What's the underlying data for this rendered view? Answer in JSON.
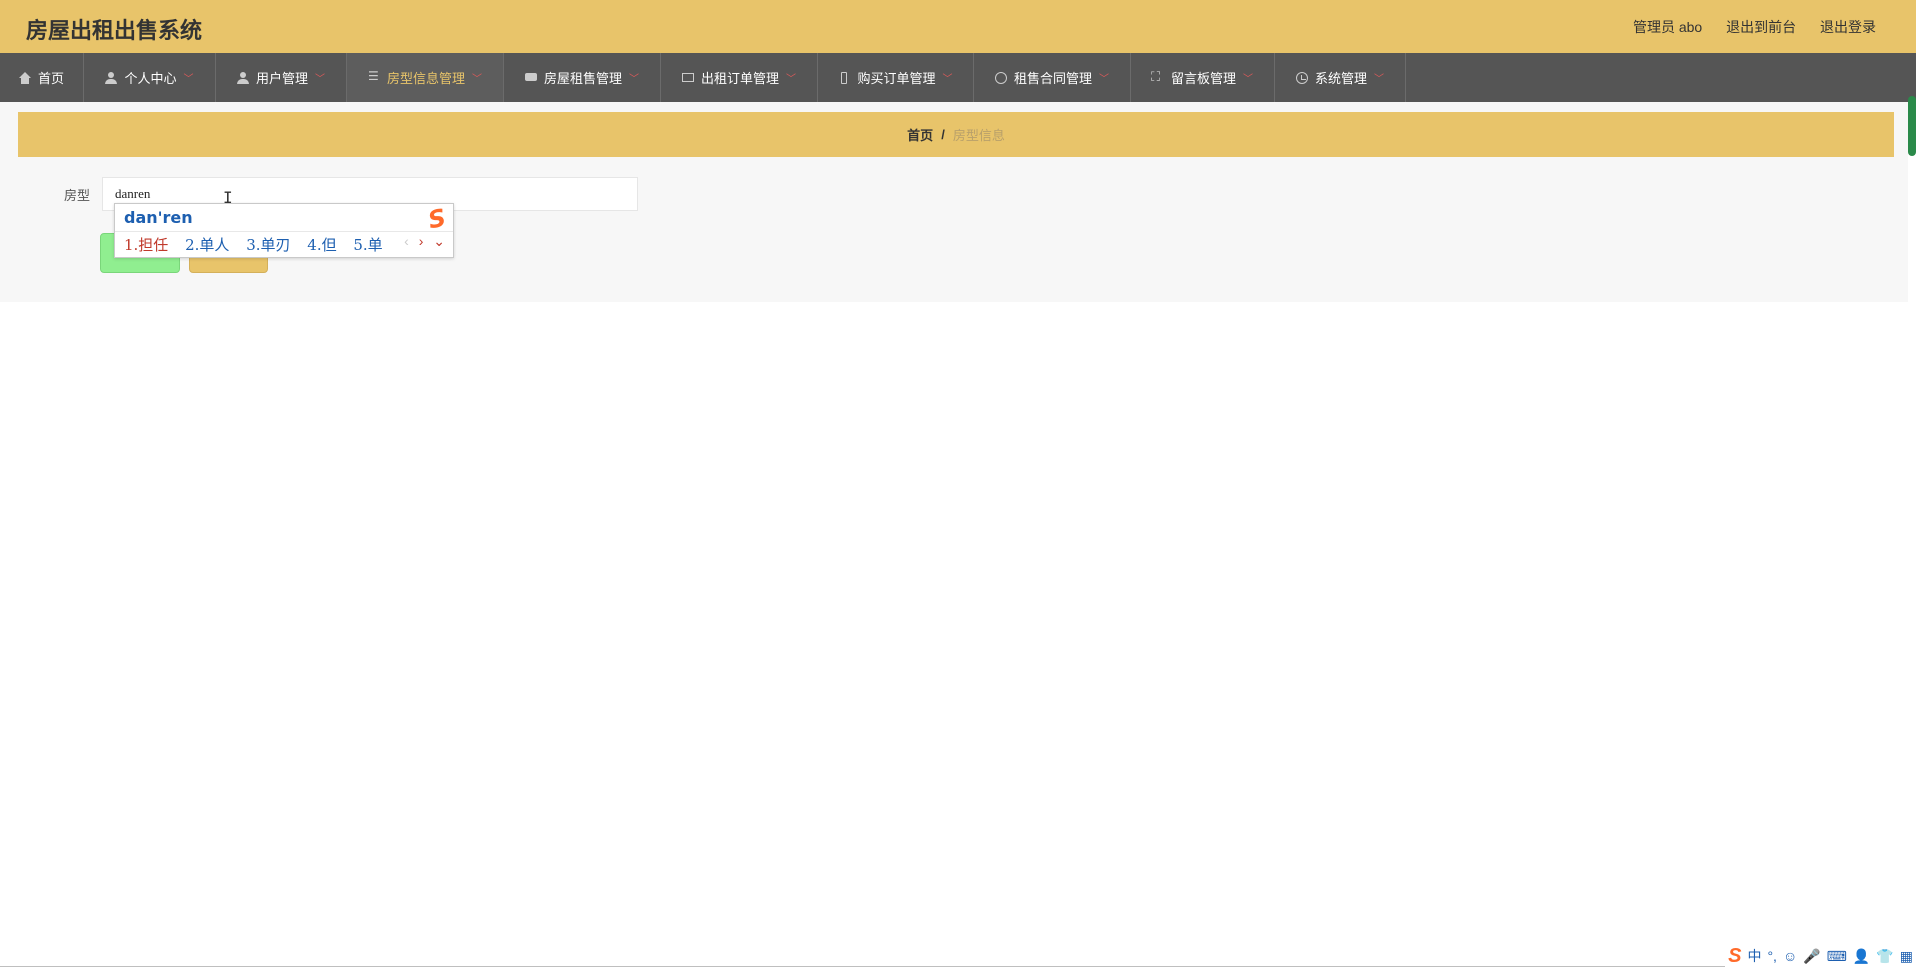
{
  "app": {
    "title": "房屋出租出售系统"
  },
  "top_links": {
    "admin": "管理员 abo",
    "frontend": "退出到前台",
    "logout": "退出登录"
  },
  "nav": {
    "items": [
      {
        "label": "首页",
        "icon": "home-icon"
      },
      {
        "label": "个人中心",
        "icon": "user-icon"
      },
      {
        "label": "用户管理",
        "icon": "user-icon"
      },
      {
        "label": "房型信息管理",
        "icon": "list-icon",
        "active": true
      },
      {
        "label": "房屋租售管理",
        "icon": "chat-icon"
      },
      {
        "label": "出租订单管理",
        "icon": "doc-icon"
      },
      {
        "label": "购买订单管理",
        "icon": "phone-icon"
      },
      {
        "label": "租售合同管理",
        "icon": "gauge-icon"
      },
      {
        "label": "留言板管理",
        "icon": "expand-icon"
      },
      {
        "label": "系统管理",
        "icon": "clock-icon"
      }
    ],
    "caret": "﹀"
  },
  "breadcrumb": {
    "home": "首页",
    "separator": "/",
    "current": "房型信息"
  },
  "search": {
    "label": "房型",
    "value": "danren"
  },
  "ime": {
    "composition": "dan'ren",
    "logo": "S",
    "candidates": [
      "1.担任",
      "2.单人",
      "3.单刃",
      "4.但",
      "5.单"
    ],
    "prev": "‹",
    "next": "›",
    "more": "⌄"
  },
  "tray": {
    "logo": "S",
    "lang": "中",
    "punct": "°,",
    "emoji": "☺",
    "mic": "🎤",
    "keyboard": "⌨",
    "user": "👤",
    "skin": "👕",
    "grid": "▦"
  },
  "colors": {
    "accent": "#e8c46a",
    "nav_bg": "#555555",
    "search_button": "#90ee90",
    "ime_blue": "#1d5fb0",
    "ime_red": "#c0392b"
  }
}
